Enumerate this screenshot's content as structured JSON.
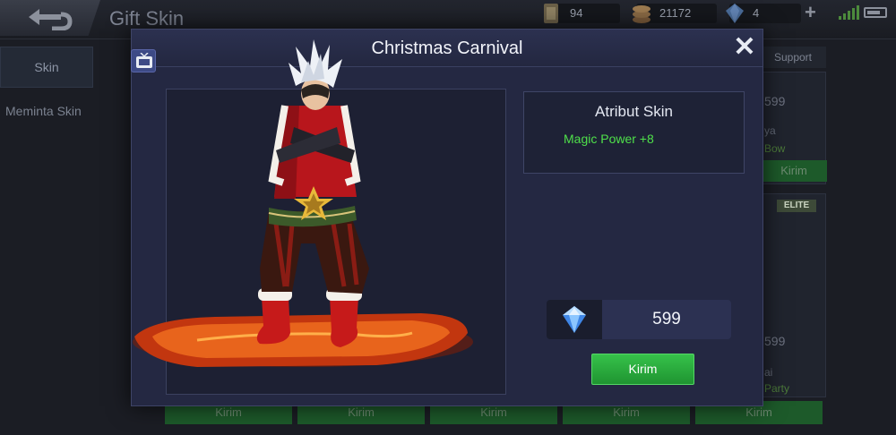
{
  "background": {
    "title": "Gift Skin",
    "resources": {
      "tickets": "94",
      "battle_points": "21172",
      "diamonds": "4"
    },
    "sidebar": {
      "items": [
        {
          "label": "Skin"
        },
        {
          "label": "Meminta Skin"
        }
      ]
    },
    "right_column": {
      "tab_label": "Support",
      "card1": {
        "price": "599",
        "name": "ya",
        "sub": "Bow",
        "button": "Kirim"
      },
      "card2": {
        "badge": "ELITE",
        "price": "599",
        "name": "ai",
        "sub": "Party"
      }
    },
    "kirim_buttons": [
      "Kirim",
      "Kirim",
      "Kirim",
      "Kirim",
      "Kirim"
    ]
  },
  "modal": {
    "title": "Christmas Carnival",
    "attribute_title": "Atribut Skin",
    "attribute_stat": "Magic Power +8",
    "price": "599",
    "send_label": "Kirim"
  },
  "colors": {
    "modal_bg": "#242842",
    "stat_green": "#4fe04a",
    "send_green": "#2bab3e",
    "diamond_blue": "#6fb4ff"
  },
  "icons": {
    "back": "back-arrow-icon",
    "close": "close-icon",
    "tv": "tv-icon",
    "diamond": "diamond-icon",
    "ticket": "ticket-icon",
    "coins": "battle-point-icon",
    "plus": "plus-icon",
    "signal": "signal-icon",
    "battery": "battery-icon"
  }
}
